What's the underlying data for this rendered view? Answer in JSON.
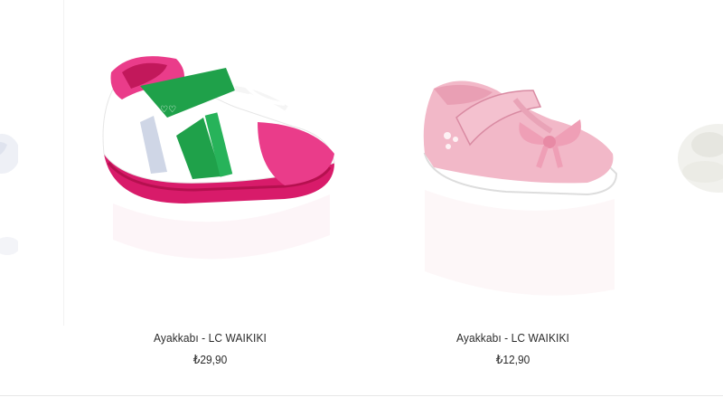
{
  "products": [
    {
      "name": "Ayakkabı - LC WAIKIKI",
      "price": "₺29,90",
      "image_icon": "pink-green-sneaker-image"
    },
    {
      "name": "Ayakkabı - LC WAIKIKI",
      "price": "₺12,90",
      "image_icon": "pink-baby-shoe-image"
    }
  ],
  "colors": {
    "text": "#2b2b2b",
    "sneaker_pink": "#e83a86",
    "sneaker_green": "#1fa14a",
    "baby_shoe_pink": "#f2b8c8"
  }
}
